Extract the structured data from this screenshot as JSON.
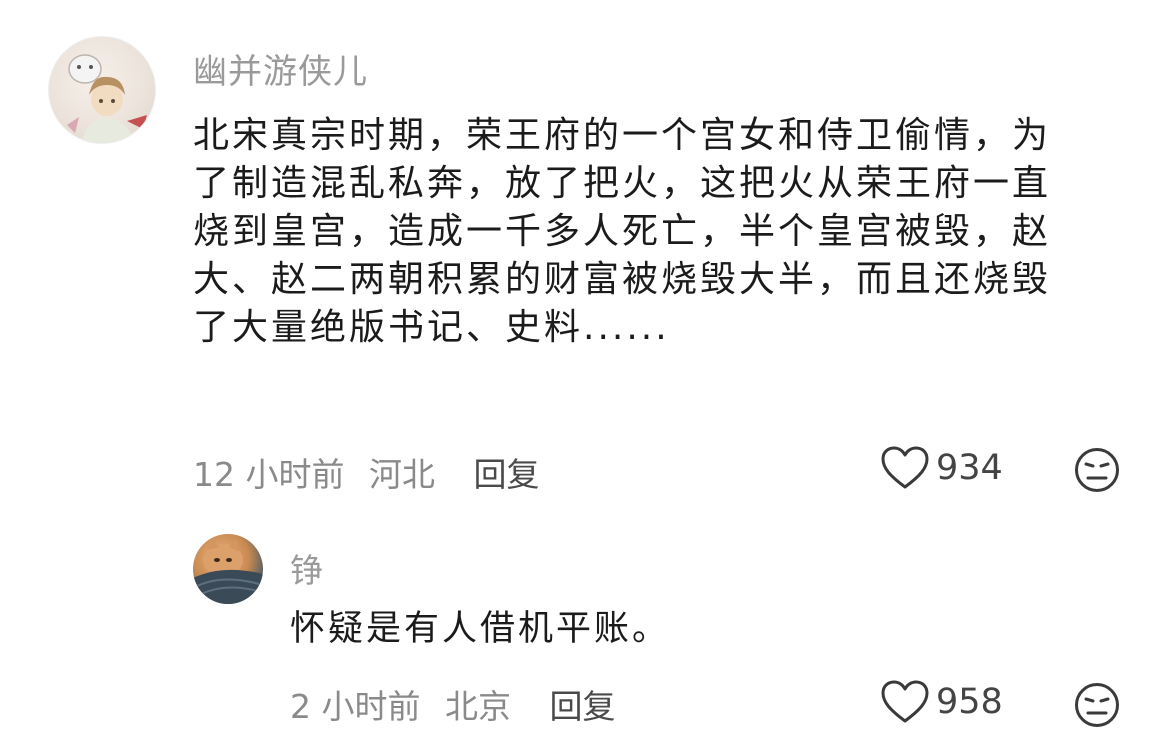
{
  "main_comment": {
    "username": "幽并游侠儿",
    "text_lines": [
      "北宋真宗时期，荣王府的一个宫女和侍卫偷情，为",
      "了制造混乱私奔，放了把火，这把火从荣王府一直",
      "烧到皇宫，造成一千多人死亡，半个皇宫被毁，赵",
      "大、赵二两朝积累的财富被烧毁大半，而且还烧毁",
      "了大量绝版书记、史料......"
    ],
    "time": "12 小时前",
    "location": "河北",
    "reply_label": "回复",
    "likes": "934",
    "avatar_icon": "anime-character-avatar",
    "like_icon": "heart-outline-icon",
    "dislike_icon": "neutral-face-icon"
  },
  "reply_comment": {
    "username": "铮",
    "text": "怀疑是有人借机平账。",
    "time": "2 小时前",
    "location": "北京",
    "reply_label": "回复",
    "likes": "958",
    "avatar_icon": "cat-photo-avatar",
    "like_icon": "heart-outline-icon",
    "dislike_icon": "neutral-face-icon"
  },
  "watermark": "",
  "colors": {
    "username": "#9a9a9a",
    "body_text": "#1b1b1b",
    "meta_text": "#8a8a8a",
    "icon_stroke": "#3a3a3a"
  }
}
